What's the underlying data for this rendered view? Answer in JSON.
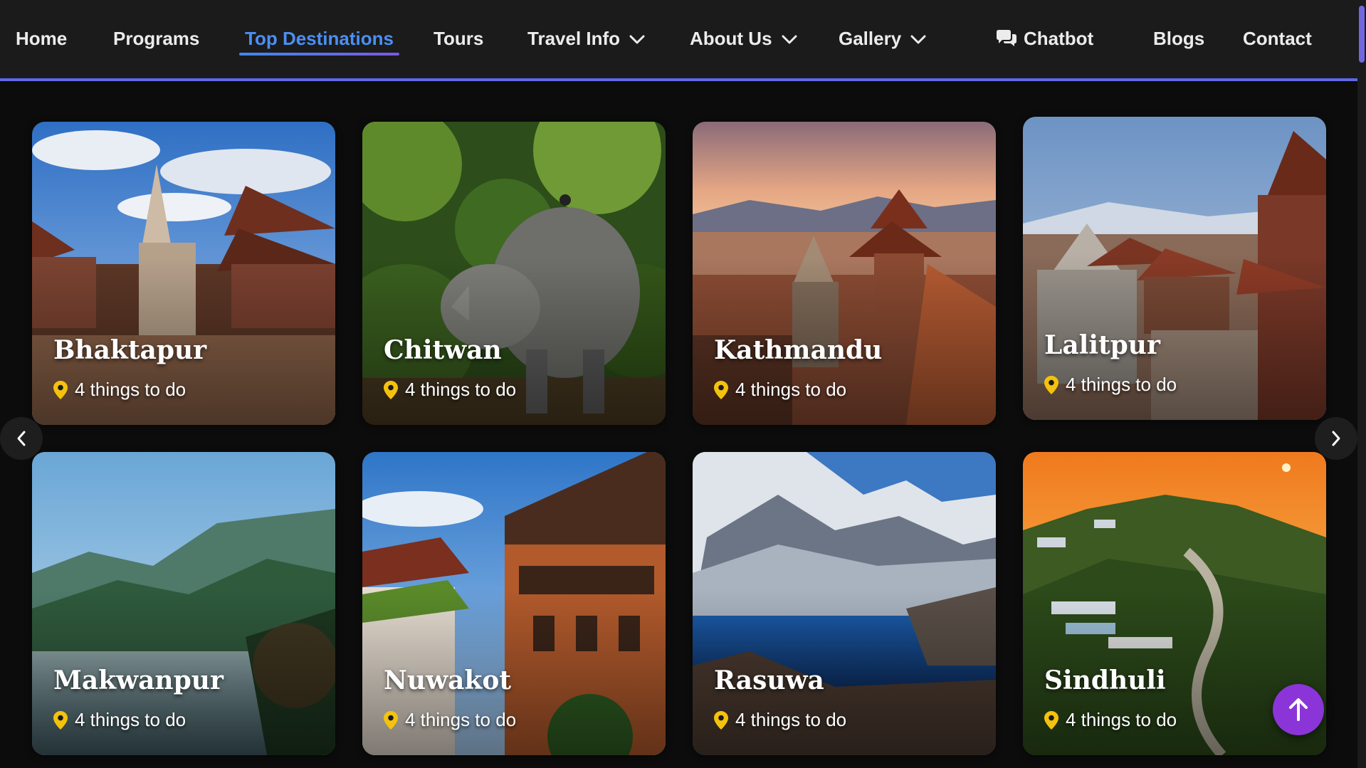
{
  "nav": {
    "home": "Home",
    "programs": "Programs",
    "top_destinations": "Top Destinations",
    "tours": "Tours",
    "travel_info": "Travel Info",
    "about_us": "About Us",
    "gallery": "Gallery",
    "chatbot": "Chatbot",
    "blogs": "Blogs",
    "contact": "Contact",
    "active_item": "Top Destinations"
  },
  "destinations": [
    {
      "name": "Bhaktapur",
      "meta": "4 things to do"
    },
    {
      "name": "Chitwan",
      "meta": "4 things to do"
    },
    {
      "name": "Kathmandu",
      "meta": "4 things to do"
    },
    {
      "name": "Lalitpur",
      "meta": "4 things to do"
    },
    {
      "name": "Makwanpur",
      "meta": "4 things to do"
    },
    {
      "name": "Nuwakot",
      "meta": "4 things to do"
    },
    {
      "name": "Rasuwa",
      "meta": "4 things to do"
    },
    {
      "name": "Sindhuli",
      "meta": "4 things to do"
    }
  ],
  "icons": {
    "dropdown": "chevron-down-icon",
    "chat": "chat-bubbles-icon",
    "location": "location-pin-icon",
    "prev": "chevron-left-icon",
    "next": "chevron-right-icon",
    "scroll_top": "arrow-up-icon"
  },
  "colors": {
    "nav_bg": "#1b1b1b",
    "nav_text": "#ececec",
    "active": "#4b8ff4",
    "nav_border": "#5f68e8",
    "pin": "#f4c20d",
    "scroll_top_bg": "#8b35d9",
    "page_bg": "#0c0c0c"
  }
}
